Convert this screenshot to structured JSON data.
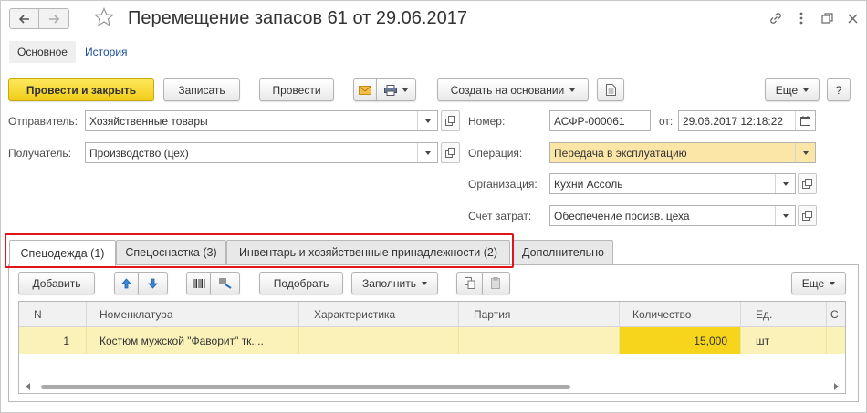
{
  "window": {
    "title": "Перемещение запасов 61 от 29.06.2017"
  },
  "sections": {
    "active": "Основное",
    "link": "История"
  },
  "toolbar": {
    "post_close": "Провести и закрыть",
    "save": "Записать",
    "post": "Провести",
    "create_basis": "Создать на основании",
    "more": "Еще"
  },
  "form": {
    "sender_label": "Отправитель:",
    "sender_value": "Хозяйственные товары",
    "receiver_label": "Получатель:",
    "receiver_value": "Производство (цех)",
    "number_label": "Номер:",
    "number_value": "АСФР-000061",
    "date_label": "от:",
    "date_value": "29.06.2017 12:18:22",
    "operation_label": "Операция:",
    "operation_value": "Передача в эксплуатацию",
    "org_label": "Организация:",
    "org_value": "Кухни Ассоль",
    "cost_label": "Счет затрат:",
    "cost_value": "Обеспечение произв. цеха"
  },
  "tabs": [
    {
      "label": "Спецодежда (1)"
    },
    {
      "label": "Спецоснастка (3)"
    },
    {
      "label": "Инвентарь и хозяйственные принадлежности (2)"
    },
    {
      "label": "Дополнительно"
    }
  ],
  "table_toolbar": {
    "add": "Добавить",
    "pick": "Подобрать",
    "fill": "Заполнить",
    "more": "Еще"
  },
  "table": {
    "columns": [
      "N",
      "Номенклатура",
      "Характеристика",
      "Партия",
      "Количество",
      "Ед.",
      "С"
    ],
    "rows": [
      {
        "n": "1",
        "item": "Костюм мужской \"Фаворит\" тк....",
        "characteristic": "",
        "batch": "",
        "qty": "15,000",
        "unit": "шт",
        "extra": ""
      }
    ]
  },
  "colors": {
    "primary_button": "#f2cc1a",
    "highlight_field": "#fbe6a7",
    "selected_row": "#fbf2b9",
    "quantity_cell": "#f7d51d",
    "annotation_box": "#e0141b",
    "link": "#1a4e9b"
  }
}
